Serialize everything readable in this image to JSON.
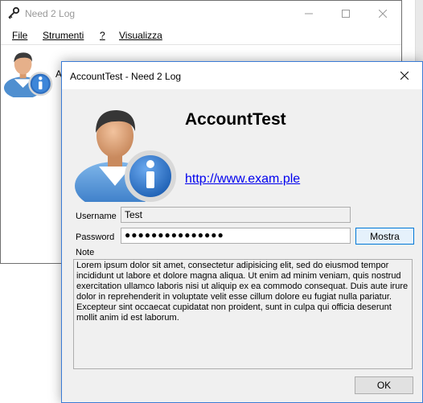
{
  "main_window": {
    "title": "Need 2 Log",
    "menu": [
      {
        "label": "File"
      },
      {
        "label": "Strumenti"
      },
      {
        "label": "?"
      },
      {
        "label": "Visualizza"
      }
    ],
    "item_label": "Acc"
  },
  "dialog": {
    "title": "AccountTest - Need 2 Log",
    "account_name": "AccountTest",
    "link": "http://www.exam.ple",
    "username_label": "Username",
    "username_value": "Test",
    "password_label": "Password",
    "password_value": "●●●●●●●●●●●●●●●",
    "show_button": "Mostra",
    "note_label": "Note",
    "note_text": "Lorem ipsum dolor sit amet, consectetur adipisicing elit, sed do eiusmod tempor incididunt ut labore et dolore magna aliqua. Ut enim ad minim veniam, quis nostrud exercitation ullamco laboris nisi ut aliquip ex ea commodo consequat. Duis aute irure dolor in reprehenderit in voluptate velit esse cillum dolore eu fugiat nulla pariatur. Excepteur sint occaecat cupidatat non proident, sunt in culpa qui officia deserunt mollit anim id est laborum.",
    "ok_button": "OK"
  },
  "icons": {
    "app": "key-icon",
    "account": "user-info-icon"
  },
  "colors": {
    "link": "#0000ee",
    "dialog_border": "#3a7bd5",
    "focus_border": "#0078d7"
  }
}
